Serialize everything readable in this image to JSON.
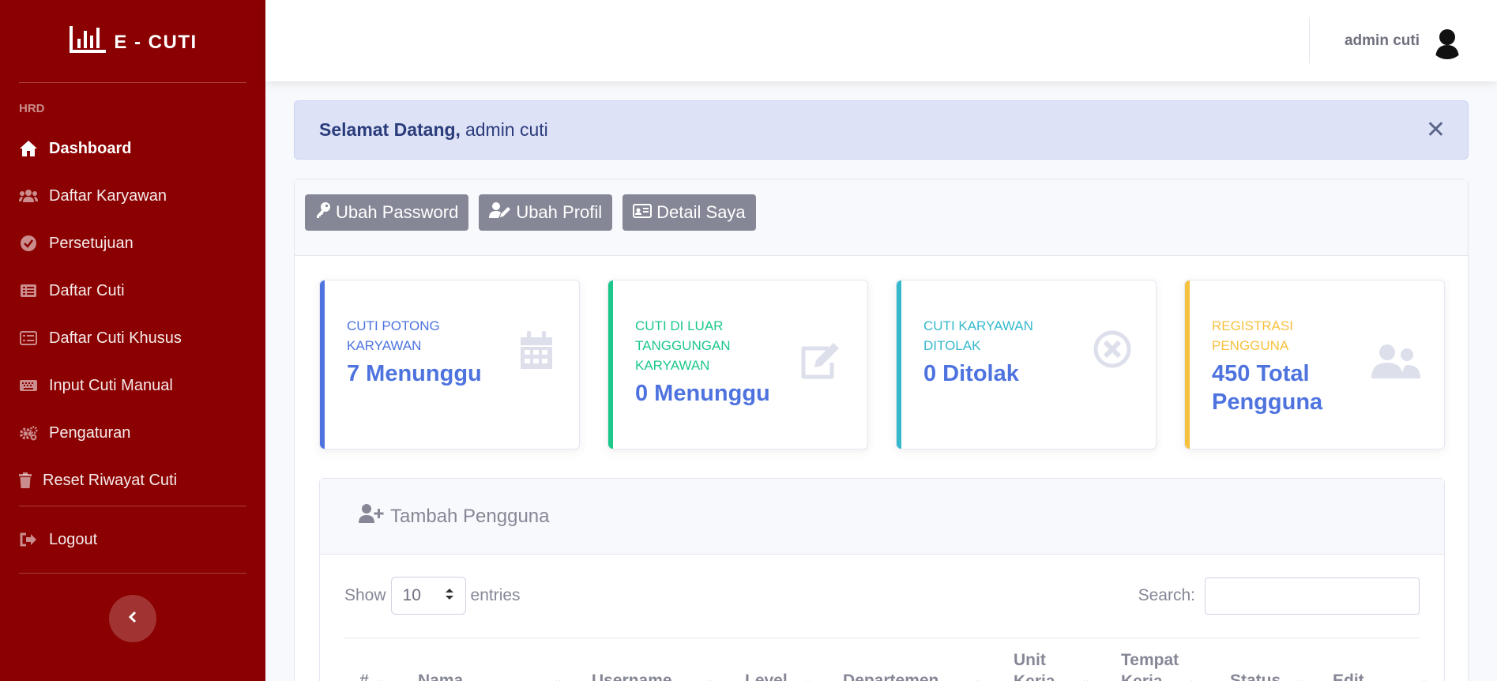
{
  "brand": {
    "name": "E - CUTI",
    "icon": "chart-bar-icon"
  },
  "sidebar": {
    "heading": "HRD",
    "items": [
      {
        "label": "Dashboard",
        "icon": "home-icon",
        "active": true
      },
      {
        "label": "Daftar Karyawan",
        "icon": "users-icon"
      },
      {
        "label": "Persetujuan",
        "icon": "check-circle-icon"
      },
      {
        "label": "Daftar Cuti",
        "icon": "list-alt-icon"
      },
      {
        "label": "Daftar Cuti Khusus",
        "icon": "list-alt-icon"
      },
      {
        "label": "Input Cuti Manual",
        "icon": "keyboard-icon"
      },
      {
        "label": "Pengaturan",
        "icon": "cogs-icon"
      },
      {
        "label": "Reset Riwayat Cuti",
        "icon": "trash-icon"
      }
    ],
    "logout": {
      "label": "Logout",
      "icon": "sign-out-icon"
    }
  },
  "topbar": {
    "user_name": "admin cuti"
  },
  "alert": {
    "greeting": "Selamat Datang,",
    "name": "admin cuti"
  },
  "actions": {
    "change_password": "Ubah Password",
    "change_profile": "Ubah Profil",
    "my_detail": "Detail Saya"
  },
  "stats": [
    {
      "label": "CUTI POTONG KARYAWAN",
      "value": "7 Menunggu",
      "color": "#4e73df",
      "icon": "calendar-icon"
    },
    {
      "label": "CUTI DI LUAR TANGGUNGAN KARYAWAN",
      "value": "0 Menunggu",
      "color": "#1cc88a",
      "icon": "edit-icon"
    },
    {
      "label": "CUTI KARYAWAN DITOLAK",
      "value": "0 Ditolak",
      "color": "#36b9cc",
      "icon": "times-circle-icon"
    },
    {
      "label": "REGISTRASI PENGGUNA",
      "value": "450 Total Pengguna",
      "color": "#f6c23e",
      "icon": "users-icon"
    }
  ],
  "users_panel": {
    "title": "Tambah Pengguna",
    "show_label": "Show",
    "entries_value": "10",
    "entries_label": "entries",
    "search_label": "Search:",
    "search_value": "",
    "columns": [
      "#",
      "Nama",
      "Username",
      "Level",
      "Departemen",
      "Unit Kerja",
      "Tempat Kerja",
      "Status",
      "Edit"
    ]
  }
}
